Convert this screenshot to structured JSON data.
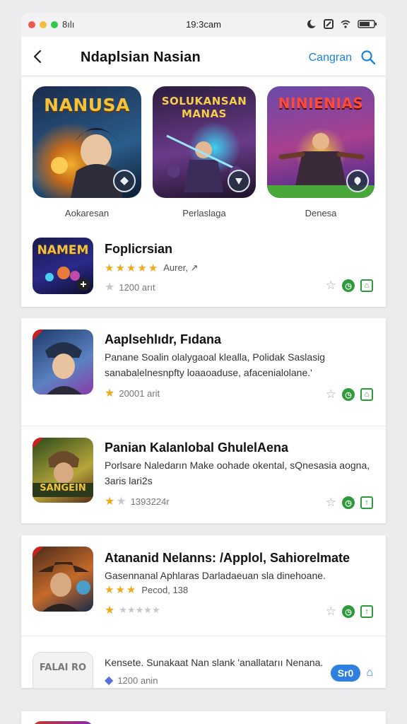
{
  "status_bar": {
    "left_text": "8ılı",
    "time": "19:3cam"
  },
  "nav": {
    "title": "Ndaplsian Nasian",
    "action_label": "Cangran"
  },
  "featured": [
    {
      "art_title": "NANUSA",
      "label": "Aokaresan",
      "colors": [
        "#1a2b4d",
        "#2a5d8a",
        "#f2b02b"
      ]
    },
    {
      "art_title": "SOLUKANSAN MANAS",
      "label": "Perlaslaga",
      "colors": [
        "#2b1d3d",
        "#6a3a8a",
        "#3bd0f0"
      ]
    },
    {
      "art_title": "NINIENIAS",
      "label": "Denesa",
      "colors": [
        "#3c2a6a",
        "#a8408f",
        "#e84040"
      ]
    }
  ],
  "top_app": {
    "icon_title": "NAMEM",
    "title": "Foplicrsian",
    "rating_text": "Aurer, ↗",
    "downloads": "1200 arıt",
    "rating": 5
  },
  "list": [
    {
      "title": "Aaplsehlıdr, Fıdana",
      "desc": "Panane Soalin olalygaoal klealla, Polidak Saslasig sanabalelnesnpfty loaaoaduse, afacenialolane.'",
      "downloads": "20001 arit",
      "rating": 1,
      "icon_colors": [
        "#1d3a6a",
        "#5c82c2"
      ]
    },
    {
      "title": "Panian Kalanlobal GhulelAena",
      "desc": "Porlsare Naledarın Make oohade okental, sQnesasia aogna, 3aris lari2s",
      "downloads": "1393224r",
      "rating": 1,
      "icon_colors": [
        "#4a5a20",
        "#b6a53a"
      ],
      "icon_title": "SANGEIN"
    },
    {
      "title": "Atananid Nelanns: /Applol, Sahiorelmate",
      "desc": "Gasennanal Aphlaras Darladaeuan sla dinehoane.",
      "rating_text": "Pecod, 138",
      "rating": 3,
      "icon_colors": [
        "#4a2a1a",
        "#c46a2a"
      ]
    },
    {
      "title": "Kensete. Sunakaat Nan slank 'anallatarıı Nenana.",
      "downloads": "1200 anin",
      "pill": "Sr0",
      "icon_title": "FALAI RO"
    }
  ]
}
